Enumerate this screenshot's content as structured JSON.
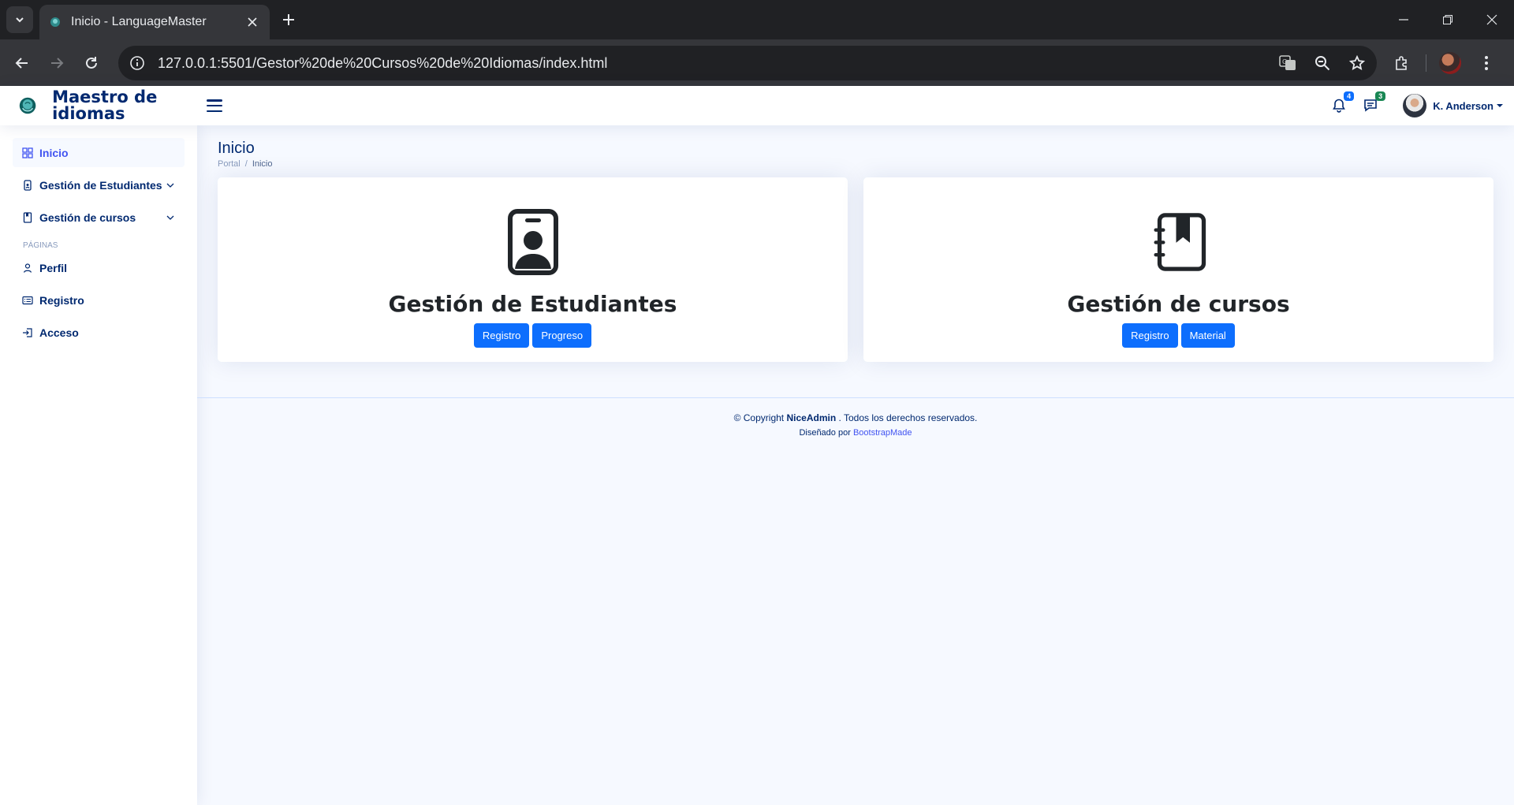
{
  "browser": {
    "tab_title": "Inicio - LanguageMaster",
    "url": "127.0.0.1:5501/Gestor%20de%20Cursos%20de%20Idiomas/index.html"
  },
  "header": {
    "logo_text": "Maestro de idiomas",
    "notifications_count": "4",
    "messages_count": "3",
    "user_name": "K. Anderson"
  },
  "sidebar": {
    "items": [
      {
        "label": "Inicio",
        "icon": "grid-icon"
      },
      {
        "label": "Gestión de Estudiantes",
        "icon": "student-card-icon"
      },
      {
        "label": "Gestión de cursos",
        "icon": "book-icon"
      }
    ],
    "pages_heading": "PÁGINAS",
    "pages": [
      {
        "label": "Perfil",
        "icon": "person-icon"
      },
      {
        "label": "Registro",
        "icon": "card-list-icon"
      },
      {
        "label": "Acceso",
        "icon": "box-arrow-in-icon"
      }
    ]
  },
  "main": {
    "page_title": "Inicio",
    "breadcrumb": [
      "Portal",
      "/",
      "Inicio"
    ],
    "cards": [
      {
        "title": "Gestión de Estudiantes",
        "icon": "person-badge-icon",
        "buttons": [
          "Registro",
          "Progreso"
        ]
      },
      {
        "title": "Gestión de cursos",
        "icon": "journal-bookmark-icon",
        "buttons": [
          "Registro",
          "Material"
        ]
      }
    ]
  },
  "footer": {
    "copyright_prefix": "© Copyright",
    "brand": "NiceAdmin",
    "rights": ". Todos los derechos reservados.",
    "designed_by": "Diseñado por",
    "designer": "BootstrapMade"
  },
  "colors": {
    "primary": "#0d6efd",
    "nav_text": "#012970",
    "active": "#4154f1",
    "background": "#f6f9ff"
  }
}
